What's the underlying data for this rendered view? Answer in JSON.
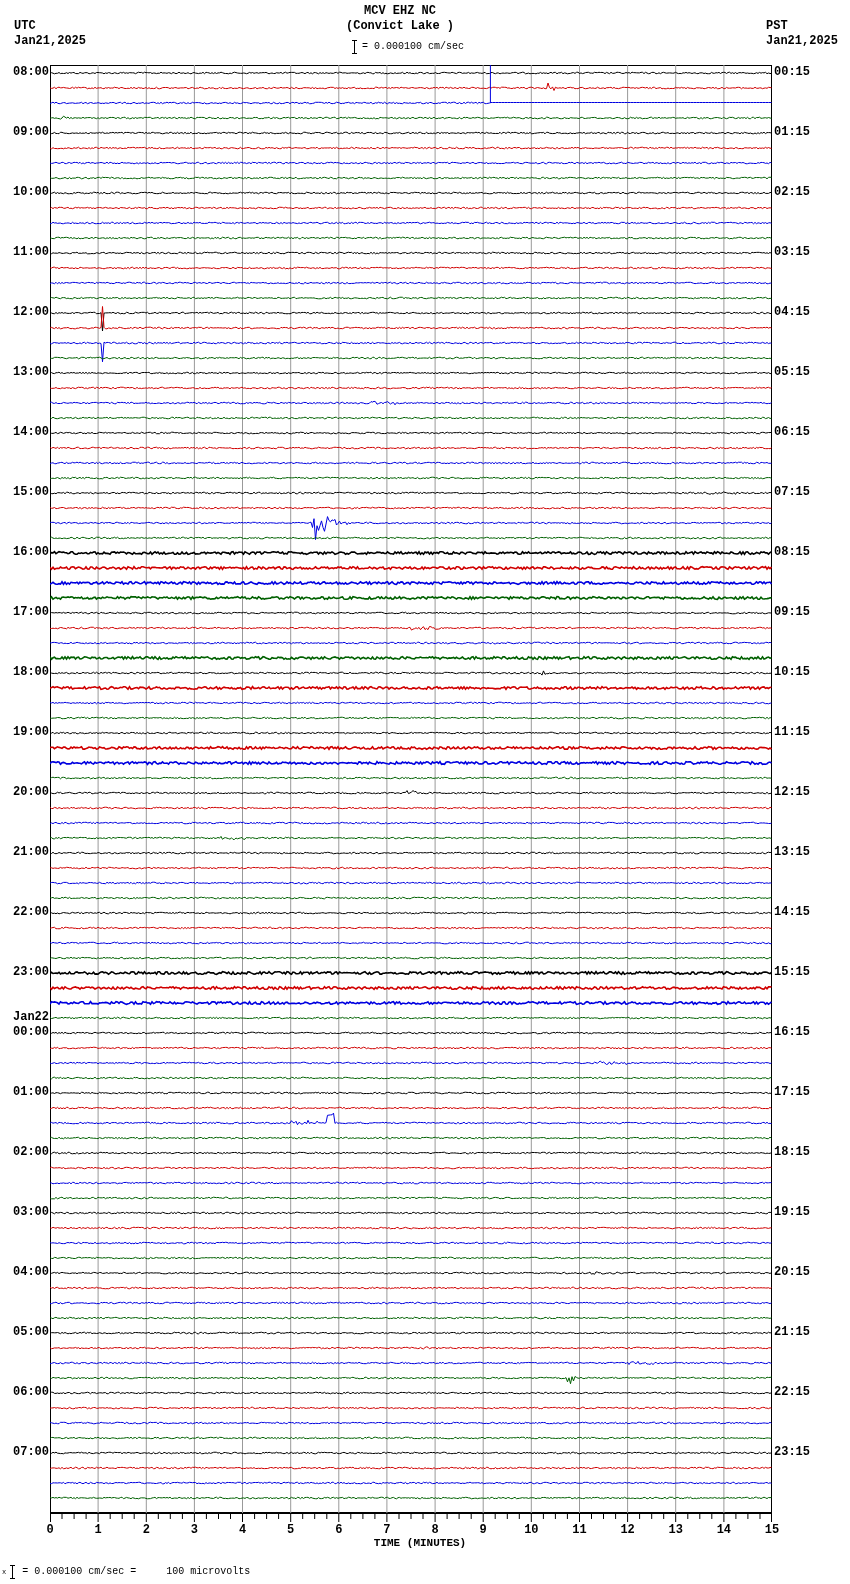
{
  "header": {
    "station": "MCV EHZ NC",
    "location": "(Convict Lake )",
    "scale": "= 0.000100 cm/sec",
    "left_zone": "UTC",
    "left_date": "Jan21,2025",
    "right_zone": "PST",
    "right_date": "Jan21,2025"
  },
  "left_labels": [
    {
      "time": "08:00"
    },
    {
      "time": "09:00"
    },
    {
      "time": "10:00"
    },
    {
      "time": "11:00"
    },
    {
      "time": "12:00"
    },
    {
      "time": "13:00"
    },
    {
      "time": "14:00"
    },
    {
      "time": "15:00"
    },
    {
      "time": "16:00"
    },
    {
      "time": "17:00"
    },
    {
      "time": "18:00"
    },
    {
      "time": "19:00"
    },
    {
      "time": "20:00"
    },
    {
      "time": "21:00"
    },
    {
      "time": "22:00"
    },
    {
      "time": "23:00"
    },
    {
      "date": "Jan22",
      "time": "00:00"
    },
    {
      "time": "01:00"
    },
    {
      "time": "02:00"
    },
    {
      "time": "03:00"
    },
    {
      "time": "04:00"
    },
    {
      "time": "05:00"
    },
    {
      "time": "06:00"
    },
    {
      "time": "07:00"
    }
  ],
  "right_labels": [
    "00:15",
    "01:15",
    "02:15",
    "03:15",
    "04:15",
    "05:15",
    "06:15",
    "07:15",
    "08:15",
    "09:15",
    "10:15",
    "11:15",
    "12:15",
    "13:15",
    "14:15",
    "15:15",
    "16:15",
    "17:15",
    "18:15",
    "19:15",
    "20:15",
    "21:15",
    "22:15",
    "23:15"
  ],
  "x_axis": {
    "ticks": [
      "0",
      "1",
      "2",
      "3",
      "4",
      "5",
      "6",
      "7",
      "8",
      "9",
      "10",
      "11",
      "12",
      "13",
      "14",
      "15"
    ],
    "label": "TIME (MINUTES)"
  },
  "footer": {
    "mark": "x",
    "text": "= 0.000100 cm/sec =     100 microvolts"
  }
}
